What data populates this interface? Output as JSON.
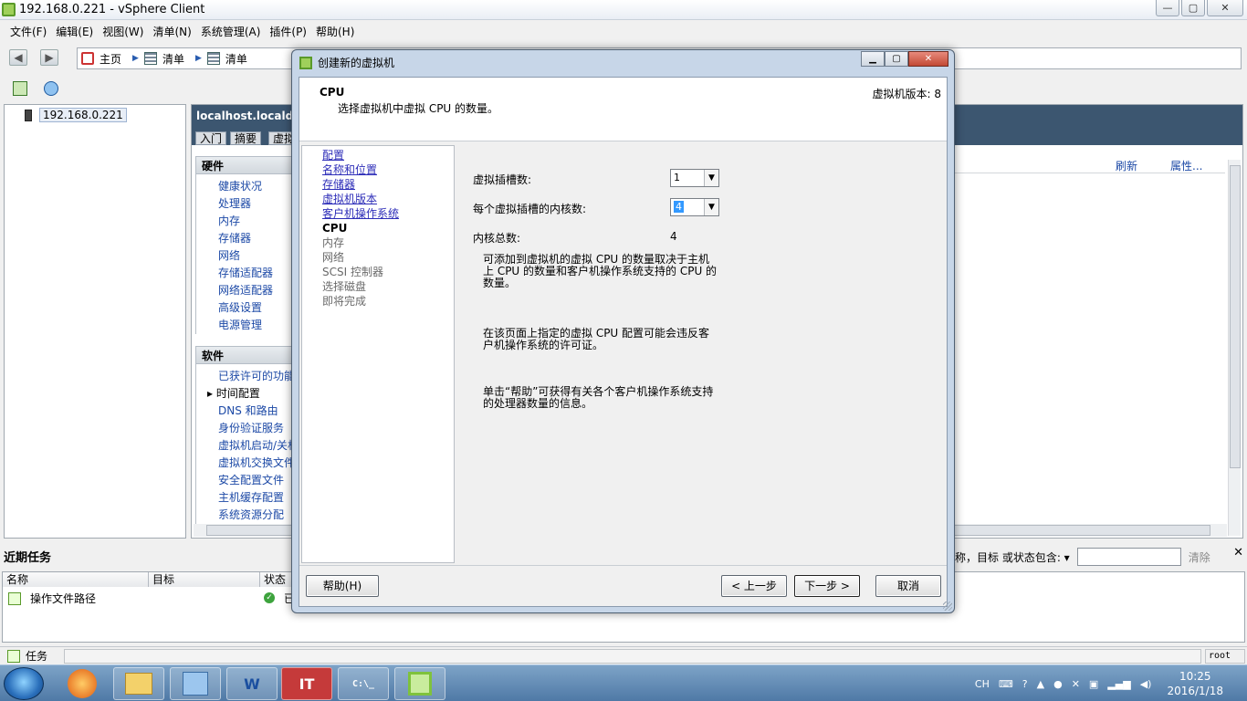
{
  "window": {
    "title": "192.168.0.221 - vSphere Client"
  },
  "menu": [
    "文件(F)",
    "编辑(E)",
    "视图(W)",
    "清单(N)",
    "系统管理(A)",
    "插件(P)",
    "帮助(H)"
  ],
  "breadcrumb": [
    "主页",
    "清单",
    "清单"
  ],
  "tree": {
    "host": "192.168.0.221"
  },
  "content": {
    "title": "localhost.localdom",
    "tabs": [
      "入门",
      "摘要",
      "虚拟"
    ],
    "hardware": {
      "header": "硬件",
      "items": [
        "健康状况",
        "处理器",
        "内存",
        "存储器",
        "网络",
        "存储适配器",
        "网络适配器",
        "高级设置",
        "电源管理"
      ]
    },
    "software": {
      "header": "软件",
      "items": [
        "已获许可的功能",
        "时间配置",
        "DNS 和路由",
        "身份验证服务",
        "虚拟机启动/关机",
        "虚拟机交换文件",
        "安全配置文件",
        "主机缓存配置",
        "系统资源分配"
      ],
      "current_index": 1
    },
    "links": {
      "refresh": "刷新",
      "properties": "属性..."
    }
  },
  "tasks": {
    "title": "近期任务",
    "filter_label": "称，目标 或状态包含: ▾",
    "filter_value": "",
    "clear": "清除",
    "columns": [
      "名称",
      "目标",
      "状态"
    ],
    "rows": [
      {
        "name": "操作文件路径",
        "status": "已"
      }
    ]
  },
  "statusbar": {
    "tasks_label": "任务",
    "user": "root"
  },
  "taskbar": {
    "apps": [
      "",
      "",
      "W",
      "IT",
      "C:\\_",
      ""
    ],
    "tray_lang": "CH",
    "time": "10:25",
    "date": "2016/1/18"
  },
  "dialog": {
    "title": "创建新的虚拟机",
    "header_title": "CPU",
    "header_subtitle": "选择虚拟机中虚拟 CPU 的数量。",
    "version": "虚拟机版本: 8",
    "steps": [
      {
        "label": "配置",
        "state": "link"
      },
      {
        "label": "名称和位置",
        "state": "link"
      },
      {
        "label": "存储器",
        "state": "link"
      },
      {
        "label": "虚拟机版本",
        "state": "link"
      },
      {
        "label": "客户机操作系统",
        "state": "link"
      },
      {
        "label": "CPU",
        "state": "current"
      },
      {
        "label": "内存",
        "state": "todo"
      },
      {
        "label": "网络",
        "state": "todo"
      },
      {
        "label": "SCSI 控制器",
        "state": "todo"
      },
      {
        "label": "选择磁盘",
        "state": "todo"
      },
      {
        "label": "即将完成",
        "state": "todo"
      }
    ],
    "form": {
      "sockets_label": "虚拟插槽数:",
      "sockets_value": "1",
      "cores_label": "每个虚拟插槽的内核数:",
      "cores_value": "4",
      "total_label": "内核总数:",
      "total_value": "4",
      "note1": "可添加到虚拟机的虚拟 CPU 的数量取决于主机上 CPU 的数量和客户机操作系统支持的 CPU 的数量。",
      "note2": "在该页面上指定的虚拟 CPU 配置可能会违反客户机操作系统的许可证。",
      "note3": "单击“帮助”可获得有关各个客户机操作系统支持的处理器数量的信息。"
    },
    "buttons": {
      "help": "帮助(H)",
      "back": "< 上一步",
      "next": "下一步 >",
      "cancel": "取消"
    }
  }
}
